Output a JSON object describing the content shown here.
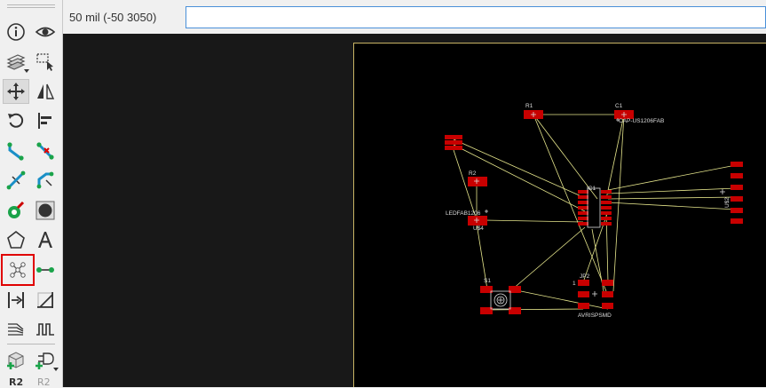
{
  "status_bar": {
    "coordinate_readout": "50 mil (-50 3050)",
    "command_value": "",
    "command_placeholder": ""
  },
  "toolbar": {
    "tools": [
      {
        "name": "info",
        "icon": "info-icon"
      },
      {
        "name": "show",
        "icon": "eye-icon"
      },
      {
        "name": "layer-settings",
        "icon": "layers-icon"
      },
      {
        "name": "mark",
        "icon": "marquee-select-icon"
      },
      {
        "name": "move",
        "icon": "move-arrows-icon",
        "pressed": true
      },
      {
        "name": "mirror",
        "icon": "mirror-icon"
      },
      {
        "name": "rotate",
        "icon": "rotate-icon"
      },
      {
        "name": "align",
        "icon": "align-icon"
      },
      {
        "name": "route",
        "icon": "route-icon"
      },
      {
        "name": "ripup",
        "icon": "ripup-icon"
      },
      {
        "name": "split",
        "icon": "split-icon"
      },
      {
        "name": "optimize",
        "icon": "optimize-icon"
      },
      {
        "name": "via",
        "icon": "via-icon"
      },
      {
        "name": "hole",
        "icon": "hole-icon"
      },
      {
        "name": "polygon",
        "icon": "polygon-icon"
      },
      {
        "name": "text",
        "icon": "text-icon"
      },
      {
        "name": "ratsnest",
        "icon": "ratsnest-icon",
        "highlighted": true
      },
      {
        "name": "signal",
        "icon": "signal-wire-icon"
      },
      {
        "name": "swap",
        "icon": "swap-icon"
      },
      {
        "name": "miter",
        "icon": "miter-icon"
      },
      {
        "name": "fanout",
        "icon": "fanout-icon"
      },
      {
        "name": "meander",
        "icon": "meander-icon"
      },
      {
        "name": "add-part",
        "icon": "add-part-icon"
      },
      {
        "name": "replace",
        "icon": "replace-icon"
      }
    ],
    "bottom_labels": [
      "R2",
      "R2"
    ]
  },
  "colors": {
    "canvas_bg": "#181818",
    "board_bg": "#000000",
    "board_outline": "#c8b464",
    "pad": "#c80000",
    "airwire": "#e6e68c",
    "silkscreen": "#dcdcdc",
    "highlight": "#e00000"
  },
  "board": {
    "components": [
      {
        "ref": "R1",
        "package": "",
        "label": "R1"
      },
      {
        "ref": "C1",
        "package": "CAP-US1206FAB",
        "label": "C1"
      },
      {
        "ref": "R2",
        "package": "",
        "label": "R2"
      },
      {
        "ref": "LED",
        "package": "LEDFAB1206",
        "label": "LEDFAB1206"
      },
      {
        "ref": "U$4",
        "package": "",
        "label": "U$4"
      },
      {
        "ref": "IC1",
        "package": "",
        "label": "IC1"
      },
      {
        "ref": "J1",
        "package": "AVRISPSMD",
        "label": "AVRISPSMD"
      },
      {
        "ref": "S1",
        "package": "",
        "label": "S1"
      },
      {
        "ref": "JP2",
        "package": "",
        "label": "JP2"
      },
      {
        "ref": "U$2",
        "package": "",
        "label": "U$2"
      }
    ],
    "labels": {
      "r1": "R1",
      "c1": "C1",
      "cap_pkg": "CAP-US1206FAB",
      "r2": "R2",
      "led_pkg": "LEDFAB1206",
      "u4": "U$4",
      "ic1": "IC1",
      "s1": "S1",
      "jp2": "JP2",
      "avr": "AVRISPSMD",
      "u2": "U$2",
      "pin1": "1"
    }
  }
}
